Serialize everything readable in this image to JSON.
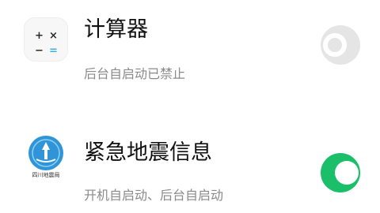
{
  "apps": [
    {
      "name": "计算器",
      "status": "后台自启动已禁止",
      "enabled": false,
      "icon": "calculator-icon",
      "icon_symbols": {
        "plus": "+",
        "times": "×",
        "minus": "−",
        "equals": "="
      }
    },
    {
      "name": "紧急地震信息",
      "status": "开机自启动、后台自启动",
      "enabled": true,
      "icon": "earthquake-alert-icon",
      "icon_caption": "四川地震局"
    }
  ],
  "colors": {
    "toggle_on": "#1bbf6a",
    "toggle_off": "#e5e5e5",
    "quake_icon_blue": "#2f95d8",
    "calc_equals": "#3ab0e0"
  }
}
